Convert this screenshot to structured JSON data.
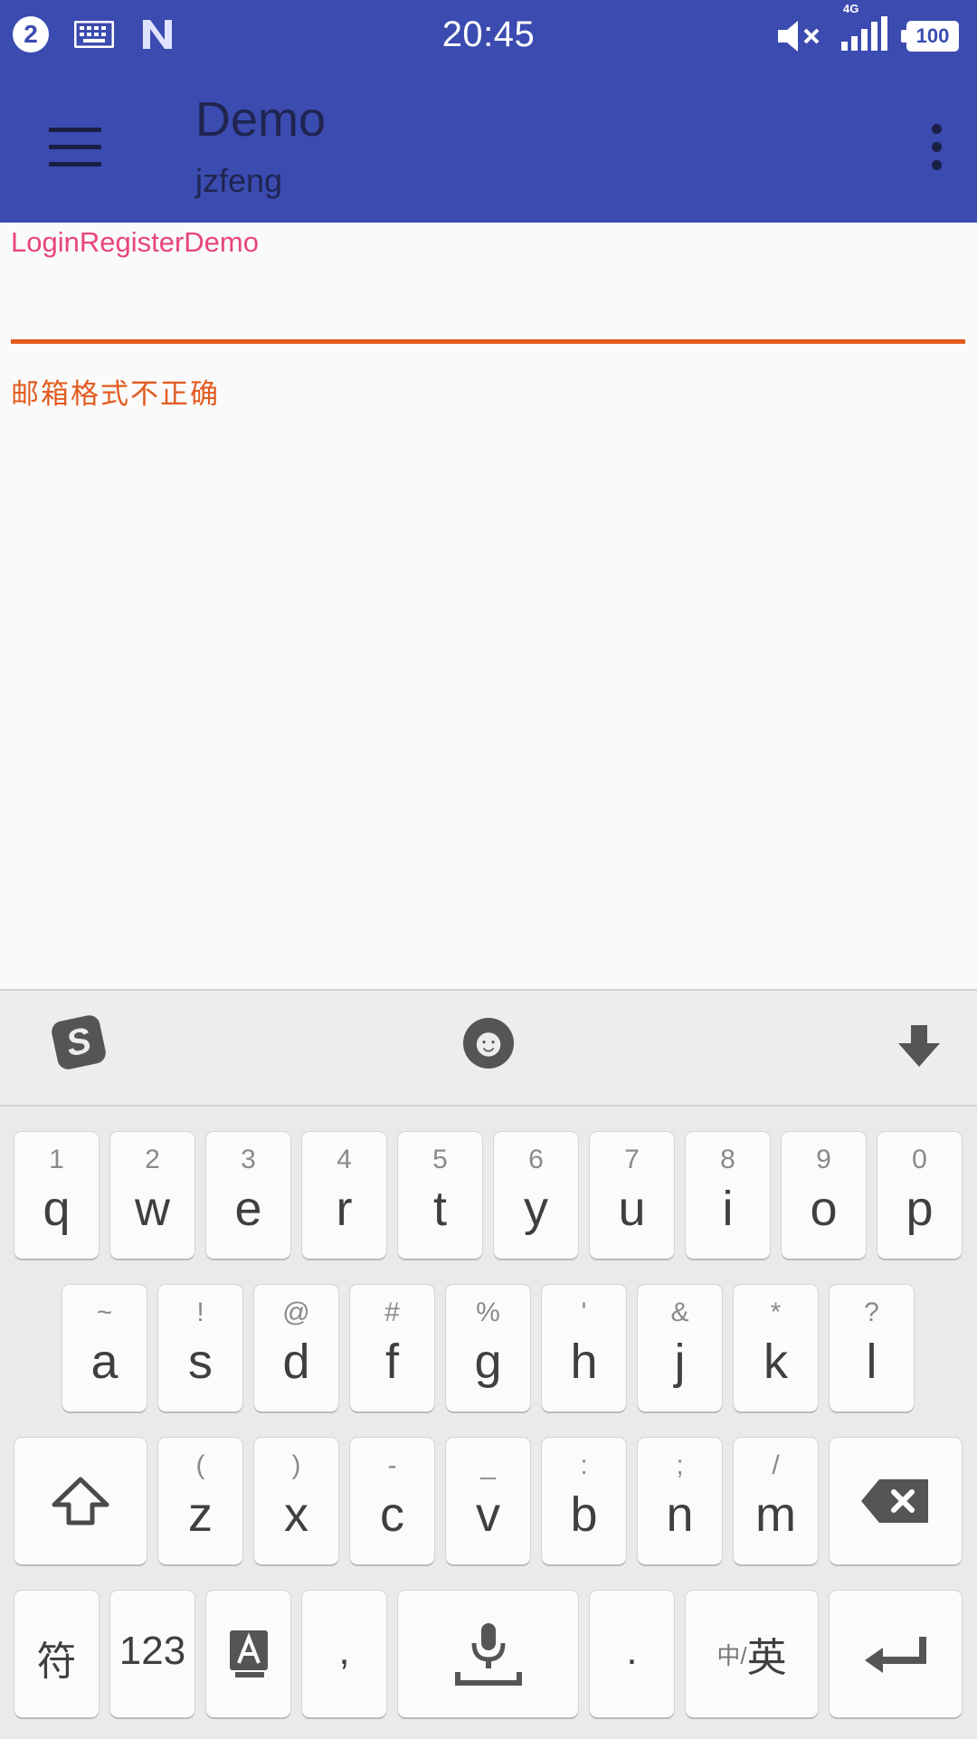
{
  "status_bar": {
    "notification_count": "2",
    "time": "20:45",
    "network": "4G",
    "battery": "100"
  },
  "app_bar": {
    "title": "Demo",
    "subtitle": "jzfeng"
  },
  "form": {
    "label": "LoginRegisterDemo",
    "input_value": "",
    "error": "邮箱格式不正确"
  },
  "keyboard": {
    "toolbar": {
      "logo": "S",
      "emoji": "☻"
    },
    "row1": [
      {
        "sym": "1",
        "ch": "q"
      },
      {
        "sym": "2",
        "ch": "w"
      },
      {
        "sym": "3",
        "ch": "e"
      },
      {
        "sym": "4",
        "ch": "r"
      },
      {
        "sym": "5",
        "ch": "t"
      },
      {
        "sym": "6",
        "ch": "y"
      },
      {
        "sym": "7",
        "ch": "u"
      },
      {
        "sym": "8",
        "ch": "i"
      },
      {
        "sym": "9",
        "ch": "o"
      },
      {
        "sym": "0",
        "ch": "p"
      }
    ],
    "row2": [
      {
        "sym": "~",
        "ch": "a"
      },
      {
        "sym": "!",
        "ch": "s"
      },
      {
        "sym": "@",
        "ch": "d"
      },
      {
        "sym": "#",
        "ch": "f"
      },
      {
        "sym": "%",
        "ch": "g"
      },
      {
        "sym": "'",
        "ch": "h"
      },
      {
        "sym": "&",
        "ch": "j"
      },
      {
        "sym": "*",
        "ch": "k"
      },
      {
        "sym": "?",
        "ch": "l"
      }
    ],
    "row3": [
      {
        "sym": "(",
        "ch": "z"
      },
      {
        "sym": ")",
        "ch": "x"
      },
      {
        "sym": "-",
        "ch": "c"
      },
      {
        "sym": "_",
        "ch": "v"
      },
      {
        "sym": ":",
        "ch": "b"
      },
      {
        "sym": ";",
        "ch": "n"
      },
      {
        "sym": "/",
        "ch": "m"
      }
    ],
    "row4": {
      "symbols": "符",
      "numbers": "123",
      "comma": ",",
      "period": ".",
      "lang_small": "中/",
      "lang_big": "英"
    }
  }
}
